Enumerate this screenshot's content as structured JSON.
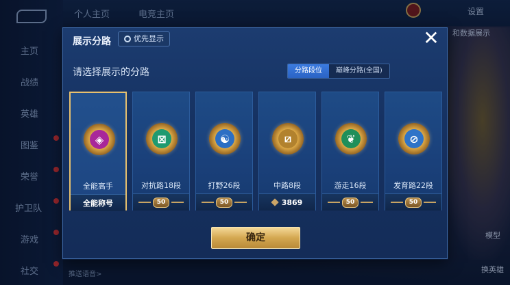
{
  "nav": {
    "items": [
      {
        "label": "主页",
        "badge": false
      },
      {
        "label": "战绩",
        "badge": false
      },
      {
        "label": "英雄",
        "badge": false
      },
      {
        "label": "图鉴",
        "badge": true
      },
      {
        "label": "荣誉",
        "badge": true
      },
      {
        "label": "护卫队",
        "badge": true
      },
      {
        "label": "游戏",
        "badge": true
      },
      {
        "label": "社交",
        "badge": true
      }
    ]
  },
  "topbar": {
    "tabs": [
      "个人主页",
      "电竞主页"
    ],
    "settings": "设置"
  },
  "side": {
    "model_label": "模型",
    "change_hero": "换英雄",
    "data_label": "和数据展示"
  },
  "bottom_hint": "推送语音>",
  "modal": {
    "title": "展示分路",
    "pref_button": "优先显示",
    "close": "✕",
    "subtitle": "请选择展示的分路",
    "toggle": [
      "分路段位",
      "巅峰分路(全国)"
    ],
    "confirm": "确定",
    "cards": [
      {
        "name": "全能高手",
        "footer": "全能称号",
        "footer_type": "text",
        "emblem_color": "#a8279a",
        "selected": true
      },
      {
        "name": "对抗路18段",
        "footer": "50",
        "footer_type": "badge",
        "emblem_color": "#1f9a70",
        "selected": false
      },
      {
        "name": "打野26段",
        "footer": "50",
        "footer_type": "badge",
        "emblem_color": "#2c6fc4",
        "selected": false
      },
      {
        "name": "中路8段",
        "footer": "3869",
        "footer_type": "score",
        "emblem_color": "#b2822e",
        "selected": false
      },
      {
        "name": "游走16段",
        "footer": "50",
        "footer_type": "badge",
        "emblem_color": "#1f8f5a",
        "selected": false
      },
      {
        "name": "发育路22段",
        "footer": "50",
        "footer_type": "badge",
        "emblem_color": "#2f74c8",
        "selected": false
      }
    ]
  }
}
